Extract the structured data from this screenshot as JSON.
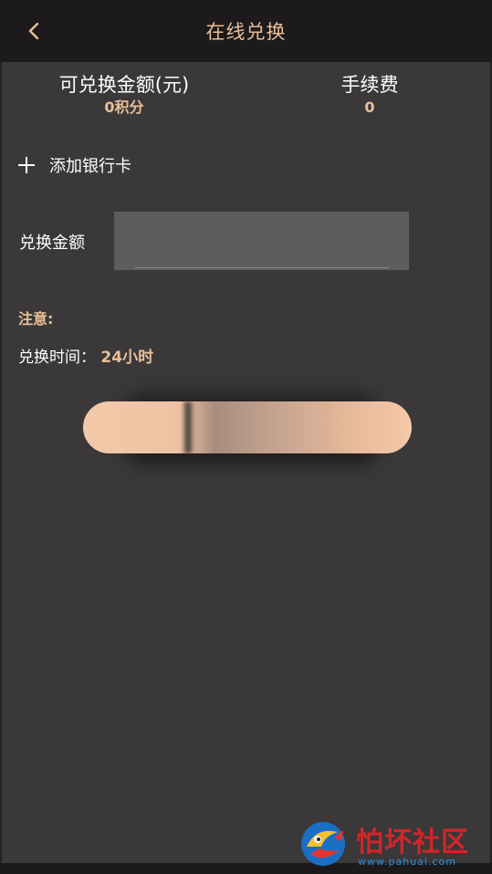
{
  "header": {
    "title": "在线兑换",
    "back_icon": "chevron-left-icon"
  },
  "stats": {
    "available": {
      "label": "可兑换金额(元)",
      "value": "0积分"
    },
    "fee": {
      "label": "手续费",
      "value": "0"
    }
  },
  "bank": {
    "add_label": "添加银行卡",
    "icon": "plus-icon"
  },
  "form": {
    "amount_label": "兑换金额",
    "amount_value": ""
  },
  "notice": {
    "title": "注意:",
    "time_label": "兑换时间：",
    "time_value": "24小时"
  },
  "submit": {
    "label": ""
  },
  "watermark": {
    "name": "怕坏社区",
    "url": "www.pahuai.com"
  },
  "colors": {
    "accent": "#e9bf98",
    "background": "#3a3839",
    "header": "#1c1a1b",
    "brand_red": "#d0262a",
    "brand_blue": "#2a8fd8"
  }
}
